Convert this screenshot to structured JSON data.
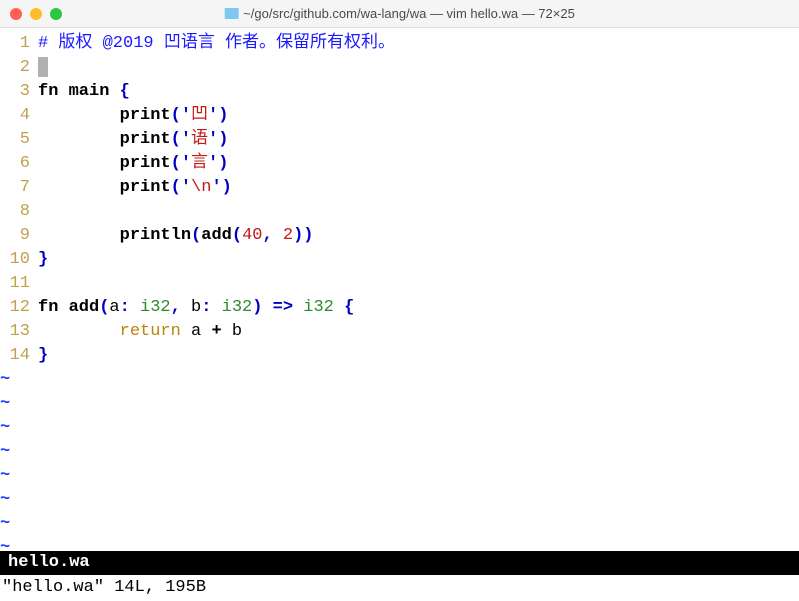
{
  "window": {
    "title": "~/go/src/github.com/wa-lang/wa — vim hello.wa — 72×25"
  },
  "lines": {
    "l1_comment": "# 版权 @2019 凹语言 作者。保留所有权利。",
    "l3_fn": "fn",
    "l3_main": " main ",
    "l3_brace": "{",
    "l4_pad": "        ",
    "l4_print": "print",
    "l4_lp": "(",
    "l4_q1": "'",
    "l4_str": "凹",
    "l4_q2": "'",
    "l4_rp": ")",
    "l5_str": "语",
    "l6_str": "言",
    "l7_str": "\\n",
    "l9_println": "println",
    "l9_add": "add",
    "l9_n1": "40",
    "l9_comma": ", ",
    "l9_n2": "2",
    "l10_brace": "}",
    "l12_fn": "fn",
    "l12_add": " add",
    "l12_lp": "(",
    "l12_a": "a",
    "l12_c1": ": ",
    "l12_t1": "i32",
    "l12_cm": ", ",
    "l12_b": "b",
    "l12_c2": ": ",
    "l12_t2": "i32",
    "l12_rp": ")",
    "l12_arrow": " => ",
    "l12_t3": "i32",
    "l12_brace": " {",
    "l13_pad": "        ",
    "l13_ret": "return",
    "l13_expr_a": " a ",
    "l13_plus": "+",
    "l13_expr_b": " b",
    "l14_brace": "}",
    "n1": "1",
    "n2": "2",
    "n3": "3",
    "n4": "4",
    "n5": "5",
    "n6": "6",
    "n7": "7",
    "n8": "8",
    "n9": "9",
    "n10": "10",
    "n11": "11",
    "n12": "12",
    "n13": "13",
    "n14": "14",
    "tilde": "~"
  },
  "status": {
    "filename": " hello.wa",
    "cmdline": "\"hello.wa\" 14L, 195B"
  }
}
